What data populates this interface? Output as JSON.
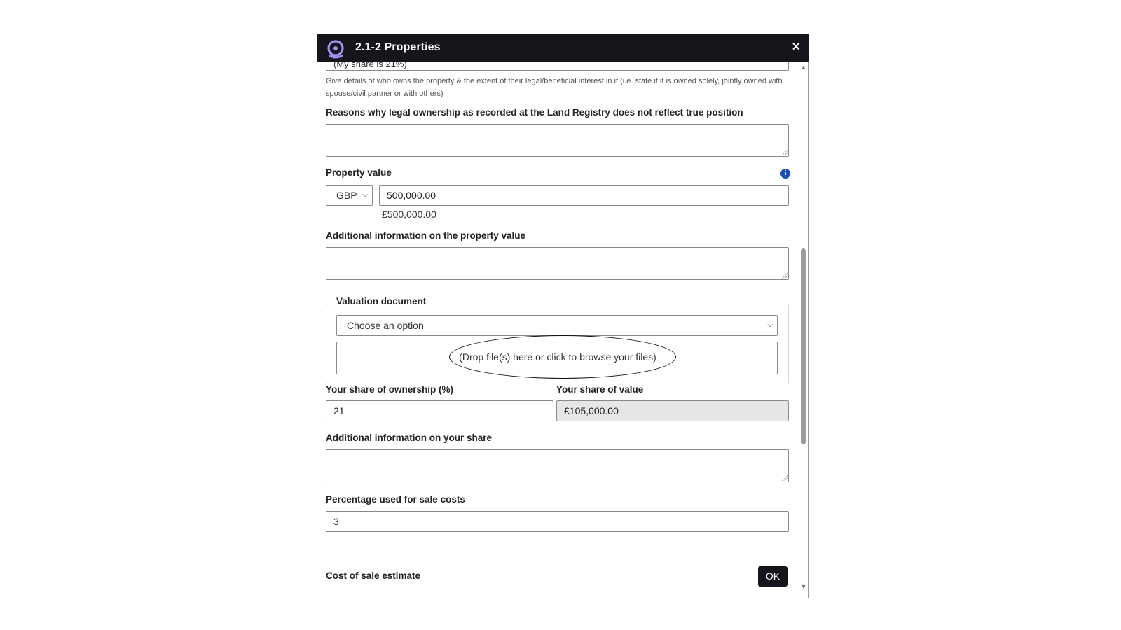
{
  "dialog": {
    "title": "2.1-2 Properties",
    "close_symbol": "×",
    "ok_label": "OK"
  },
  "ownership_details": {
    "partial_value": "(My share is 21%)",
    "hint": "Give details of who owns the property & the extent of their legal/beneficial interest in it (i.e. state if it is owned solely, jointly owned with spouse/civil partner or with others)"
  },
  "land_registry": {
    "label": "Reasons why legal ownership as recorded at the Land Registry does not reflect true position",
    "value": ""
  },
  "property_value": {
    "label": "Property value",
    "currency": "GBP",
    "amount": "500,000.00",
    "formatted": "£500,000.00",
    "info_icon": "info-icon"
  },
  "additional_property_value": {
    "label": "Additional information on the property value",
    "value": ""
  },
  "valuation_document": {
    "legend": "Valuation document",
    "select_placeholder": "Choose an option",
    "dropzone_text": "(Drop file(s) here or click to browse your files)"
  },
  "share": {
    "ownership_label": "Your share of ownership (%)",
    "ownership_value": "21",
    "value_label": "Your share of value",
    "value_value": "£105,000.00"
  },
  "additional_share": {
    "label": "Additional information on your share",
    "value": ""
  },
  "sale_costs": {
    "label": "Percentage used for sale costs",
    "value": "3"
  },
  "cost_of_sale_estimate": {
    "label": "Cost of sale estimate"
  },
  "colors": {
    "titlebar": "#14161c",
    "info_icon": "#1b4db3",
    "readonly_field": "#e6e6e6"
  }
}
